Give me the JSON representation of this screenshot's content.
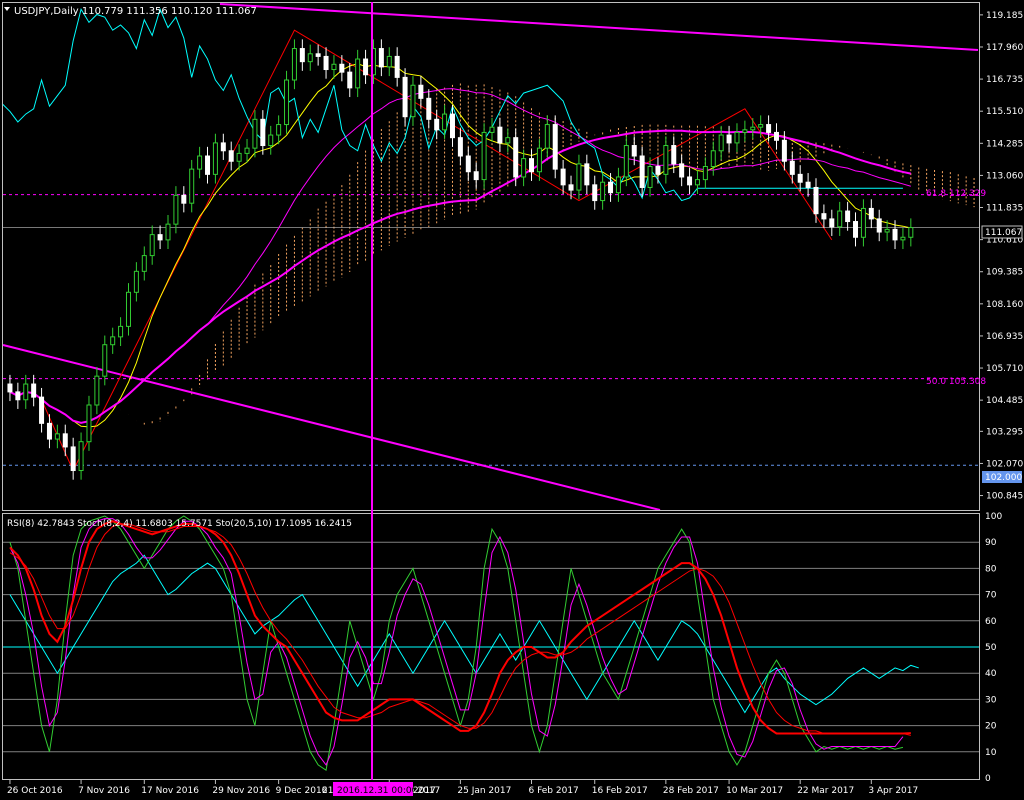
{
  "header": {
    "main_title": "USDJPY,Daily  110.779 111.356 110.120 111.067",
    "indicator_title": "RSI(8) 42.7843  Stoch(8,2,4) 11.6803 15.7571  Sto(20,5,10) 17.1095 16.2415"
  },
  "colors": {
    "background": "#000000",
    "axis": "#c0c0c0",
    "bull": "#32cd32",
    "bear": "#ffffff",
    "magenta": "#ff00ff",
    "cyan": "#00ffff",
    "yellow": "#ffff00",
    "red": "#ff0000",
    "sand": "#f4a460"
  },
  "chart_data": [
    {
      "type": "candlestick",
      "symbol": "USDJPY",
      "timeframe": "Daily",
      "ohlc_last": {
        "open": 110.779,
        "high": 111.356,
        "low": 110.12,
        "close": 111.067
      },
      "ylim": [
        100.37,
        119.6
      ],
      "y_ticks": [
        "119.185",
        "117.960",
        "116.735",
        "115.510",
        "114.285",
        "113.060",
        "111.835",
        "110.610",
        "109.385",
        "108.160",
        "106.935",
        "105.710",
        "104.485",
        "103.295",
        "102.070",
        "100.845"
      ],
      "x_ticks": [
        "26 Oct 2016",
        "7 Nov 2016",
        "17 Nov 2016",
        "29 Nov 2016",
        "9 Dec 2016",
        "13 Jan 2017",
        "25 Jan 2017",
        "6 Feb 2017",
        "16 Feb 2017",
        "28 Feb 2017",
        "10 Mar 2017",
        "22 Mar 2017",
        "3 Apr 2017"
      ],
      "x_tick_partial_left": "21",
      "x_tick_partial_right": "2017",
      "cursor_date_label": "2016.12.31 00:00",
      "price_label": "111.067",
      "level_label": "102.000",
      "fibo": [
        {
          "label": "61.8 112.329",
          "value": 112.329
        },
        {
          "label": "50.0 105.308",
          "value": 105.308
        }
      ],
      "horizontal_level": 102.0,
      "closes": [
        104.8,
        104.5,
        105.1,
        104.6,
        103.6,
        103.0,
        103.2,
        102.7,
        101.8,
        102.9,
        104.3,
        105.4,
        106.6,
        106.9,
        107.3,
        108.6,
        109.4,
        110.0,
        110.8,
        110.6,
        111.2,
        112.3,
        112.0,
        113.3,
        113.8,
        113.1,
        114.3,
        114.0,
        113.6,
        113.9,
        114.1,
        115.2,
        114.2,
        114.6,
        115.0,
        116.7,
        117.9,
        117.4,
        117.7,
        117.6,
        117.1,
        117.3,
        117.0,
        116.4,
        117.5,
        116.9,
        117.9,
        117.2,
        117.6,
        116.8,
        115.3,
        116.5,
        116.0,
        115.2,
        114.8,
        115.4,
        114.5,
        113.8,
        113.2,
        112.9,
        114.7,
        114.9,
        114.3,
        114.5,
        113.0,
        113.7,
        113.2,
        114.1,
        115.0,
        113.3,
        112.7,
        112.5,
        113.5,
        112.7,
        112.1,
        112.8,
        112.4,
        113.0,
        114.2,
        113.8,
        112.6,
        113.4,
        113.1,
        114.2,
        113.5,
        113.0,
        112.7,
        112.9,
        113.4,
        114.0,
        114.6,
        114.3,
        114.7,
        114.8,
        114.9,
        115.0,
        114.7,
        114.4,
        113.6,
        113.1,
        112.8,
        112.6,
        111.6,
        111.4,
        111.1,
        111.7,
        111.3,
        110.7,
        111.8,
        111.4,
        110.9,
        111.0,
        110.6,
        110.7,
        111.07
      ]
    },
    {
      "type": "line",
      "indicators": [
        {
          "name": "RSI(8)",
          "last": 42.7843
        },
        {
          "name": "Stoch(8,2,4)",
          "main": 11.6803,
          "signal": 15.7571
        },
        {
          "name": "Sto(20,5,10)",
          "main": 17.1095,
          "signal": 16.2415
        }
      ],
      "ylim": [
        0,
        100
      ],
      "y_ticks": [
        "100",
        "90",
        "80",
        "70",
        "60",
        "50",
        "40",
        "30",
        "20",
        "10",
        "0"
      ],
      "levels": [
        90,
        80,
        70,
        60,
        50,
        40,
        30,
        20,
        10
      ],
      "rsi": [
        70,
        65,
        60,
        55,
        50,
        45,
        40,
        45,
        50,
        55,
        60,
        65,
        70,
        75,
        78,
        80,
        82,
        85,
        80,
        75,
        70,
        72,
        75,
        78,
        80,
        82,
        80,
        75,
        70,
        65,
        60,
        55,
        58,
        60,
        62,
        65,
        68,
        70,
        65,
        60,
        55,
        50,
        45,
        40,
        35,
        40,
        45,
        50,
        55,
        50,
        45,
        40,
        45,
        50,
        55,
        60,
        55,
        50,
        45,
        40,
        45,
        50,
        55,
        50,
        45,
        50,
        55,
        60,
        55,
        50,
        45,
        40,
        35,
        30,
        35,
        40,
        45,
        50,
        55,
        60,
        55,
        50,
        45,
        50,
        55,
        60,
        58,
        55,
        50,
        45,
        40,
        35,
        30,
        25,
        30,
        35,
        40,
        42,
        38,
        35,
        32,
        30,
        28,
        30,
        32,
        35,
        38,
        40,
        42,
        40,
        38,
        40,
        42,
        41,
        43,
        42
      ],
      "stoch_fast": [
        90,
        80,
        60,
        40,
        20,
        10,
        30,
        60,
        85,
        95,
        98,
        99,
        100,
        98,
        95,
        90,
        85,
        80,
        85,
        90,
        95,
        98,
        100,
        98,
        95,
        90,
        85,
        80,
        70,
        50,
        30,
        20,
        40,
        60,
        50,
        40,
        30,
        20,
        10,
        5,
        3,
        20,
        40,
        60,
        50,
        40,
        30,
        40,
        60,
        70,
        75,
        80,
        70,
        60,
        50,
        40,
        30,
        20,
        30,
        50,
        80,
        95,
        90,
        80,
        60,
        40,
        20,
        10,
        20,
        40,
        60,
        80,
        70,
        60,
        50,
        40,
        35,
        30,
        40,
        50,
        60,
        70,
        80,
        85,
        90,
        95,
        90,
        70,
        50,
        30,
        20,
        10,
        5,
        10,
        20,
        30,
        40,
        45,
        40,
        30,
        20,
        15,
        10,
        12,
        11,
        12,
        11,
        12,
        11,
        12,
        11,
        12,
        11,
        11.68
      ],
      "stoch_fast_signal": [
        88,
        82,
        70,
        55,
        35,
        20,
        25,
        45,
        70,
        88,
        95,
        98,
        99,
        99,
        97,
        93,
        88,
        84,
        84,
        87,
        91,
        95,
        98,
        98,
        96,
        93,
        88,
        84,
        78,
        62,
        44,
        30,
        32,
        48,
        52,
        46,
        36,
        26,
        16,
        9,
        5,
        12,
        28,
        46,
        52,
        46,
        36,
        36,
        48,
        62,
        70,
        76,
        74,
        66,
        56,
        46,
        36,
        26,
        26,
        40,
        64,
        86,
        92,
        86,
        72,
        52,
        32,
        18,
        16,
        28,
        46,
        66,
        74,
        66,
        56,
        46,
        38,
        32,
        34,
        44,
        54,
        64,
        74,
        82,
        88,
        92,
        92,
        82,
        62,
        42,
        27,
        16,
        9,
        8,
        14,
        24,
        34,
        41,
        42,
        36,
        26,
        18,
        13,
        11,
        12,
        12,
        12,
        12,
        12,
        12,
        12,
        12,
        12,
        15.76
      ],
      "stoch_slow": [
        88,
        85,
        80,
        72,
        62,
        55,
        52,
        58,
        68,
        80,
        90,
        95,
        97,
        98,
        97,
        96,
        95,
        94,
        93,
        94,
        95,
        96,
        97,
        97,
        96,
        95,
        93,
        90,
        85,
        78,
        70,
        62,
        58,
        55,
        52,
        50,
        45,
        40,
        35,
        30,
        25,
        23,
        22,
        22,
        22,
        24,
        26,
        28,
        30,
        30,
        30,
        30,
        28,
        26,
        24,
        22,
        20,
        18,
        18,
        20,
        25,
        32,
        40,
        45,
        48,
        50,
        50,
        48,
        46,
        46,
        48,
        52,
        55,
        58,
        60,
        62,
        64,
        66,
        68,
        70,
        72,
        74,
        76,
        78,
        80,
        82,
        82,
        80,
        76,
        70,
        62,
        52,
        42,
        34,
        27,
        22,
        19,
        17,
        17,
        17,
        17,
        17,
        17,
        17,
        17,
        17,
        17,
        17,
        17,
        17,
        17,
        17,
        17,
        17,
        17.11
      ],
      "stoch_slow_signal": [
        86,
        84,
        81,
        76,
        69,
        62,
        57,
        57,
        62,
        70,
        80,
        88,
        93,
        96,
        97,
        97,
        96,
        95,
        94,
        94,
        94,
        95,
        96,
        96,
        96,
        95,
        94,
        92,
        89,
        84,
        78,
        71,
        65,
        60,
        56,
        53,
        49,
        45,
        40,
        35,
        31,
        27,
        25,
        24,
        23,
        23,
        24,
        25,
        27,
        28,
        29,
        30,
        29,
        28,
        26,
        24,
        22,
        20,
        19,
        19,
        21,
        25,
        31,
        37,
        42,
        45,
        47,
        48,
        48,
        47,
        47,
        48,
        50,
        53,
        55,
        57,
        59,
        61,
        63,
        65,
        67,
        69,
        71,
        73,
        75,
        77,
        79,
        80,
        79,
        77,
        73,
        67,
        59,
        51,
        43,
        36,
        30,
        25,
        22,
        20,
        19,
        18,
        18,
        17,
        17,
        17,
        17,
        17,
        17,
        17,
        17,
        17,
        17,
        17,
        16.24
      ]
    }
  ]
}
